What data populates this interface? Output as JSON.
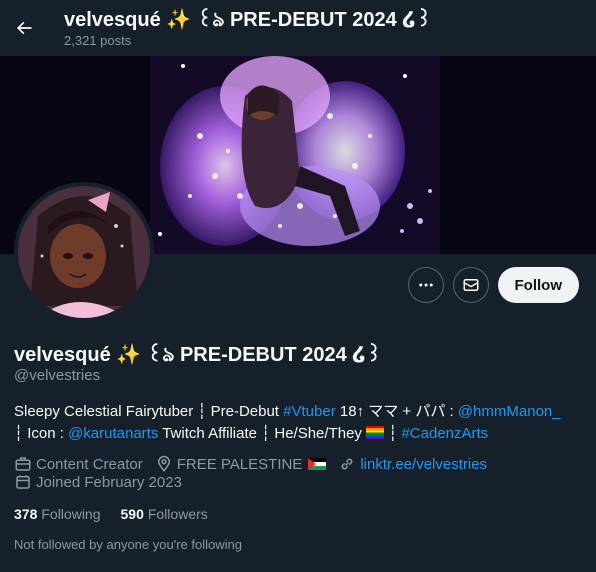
{
  "header": {
    "title": "velvesqué ✨ ꒰ঌ PRE-DEBUT 2024 ໒꒱",
    "posts": "2,321 posts"
  },
  "profile": {
    "name": "velvesqué ✨ ꒰ঌ PRE-DEBUT 2024 ໒꒱",
    "handle": "@velvestries",
    "follow_label": "Follow",
    "bio": {
      "t1": "Sleepy Celestial Fairytuber ┆ Pre-Debut ",
      "link1": "#Vtuber",
      "t2": " 18↑ ママ + パパ : ",
      "link2": "@hmmManon_",
      "t3": " ┆ Icon : ",
      "link3": "@karutanarts",
      "t4": " Twitch Affiliate ┆ He/She/They ",
      "t5": " ┆ ",
      "link4": "#CadenzArts"
    },
    "meta": {
      "category": "Content Creator",
      "location": "FREE PALESTINE",
      "website": "linktr.ee/velvestries",
      "joined": "Joined February 2023"
    },
    "stats": {
      "following_count": "378",
      "following_label": "Following",
      "followers_count": "590",
      "followers_label": "Followers"
    },
    "not_followed": "Not followed by anyone you're following"
  },
  "icons": [
    "back-arrow-icon",
    "more-icon",
    "message-icon",
    "briefcase-icon",
    "location-icon",
    "link-icon",
    "calendar-icon"
  ],
  "colors": {
    "background": "#15202b",
    "accent": "#1d9bf0",
    "muted": "#8b98a5",
    "follow_bg": "#eff3f4"
  }
}
